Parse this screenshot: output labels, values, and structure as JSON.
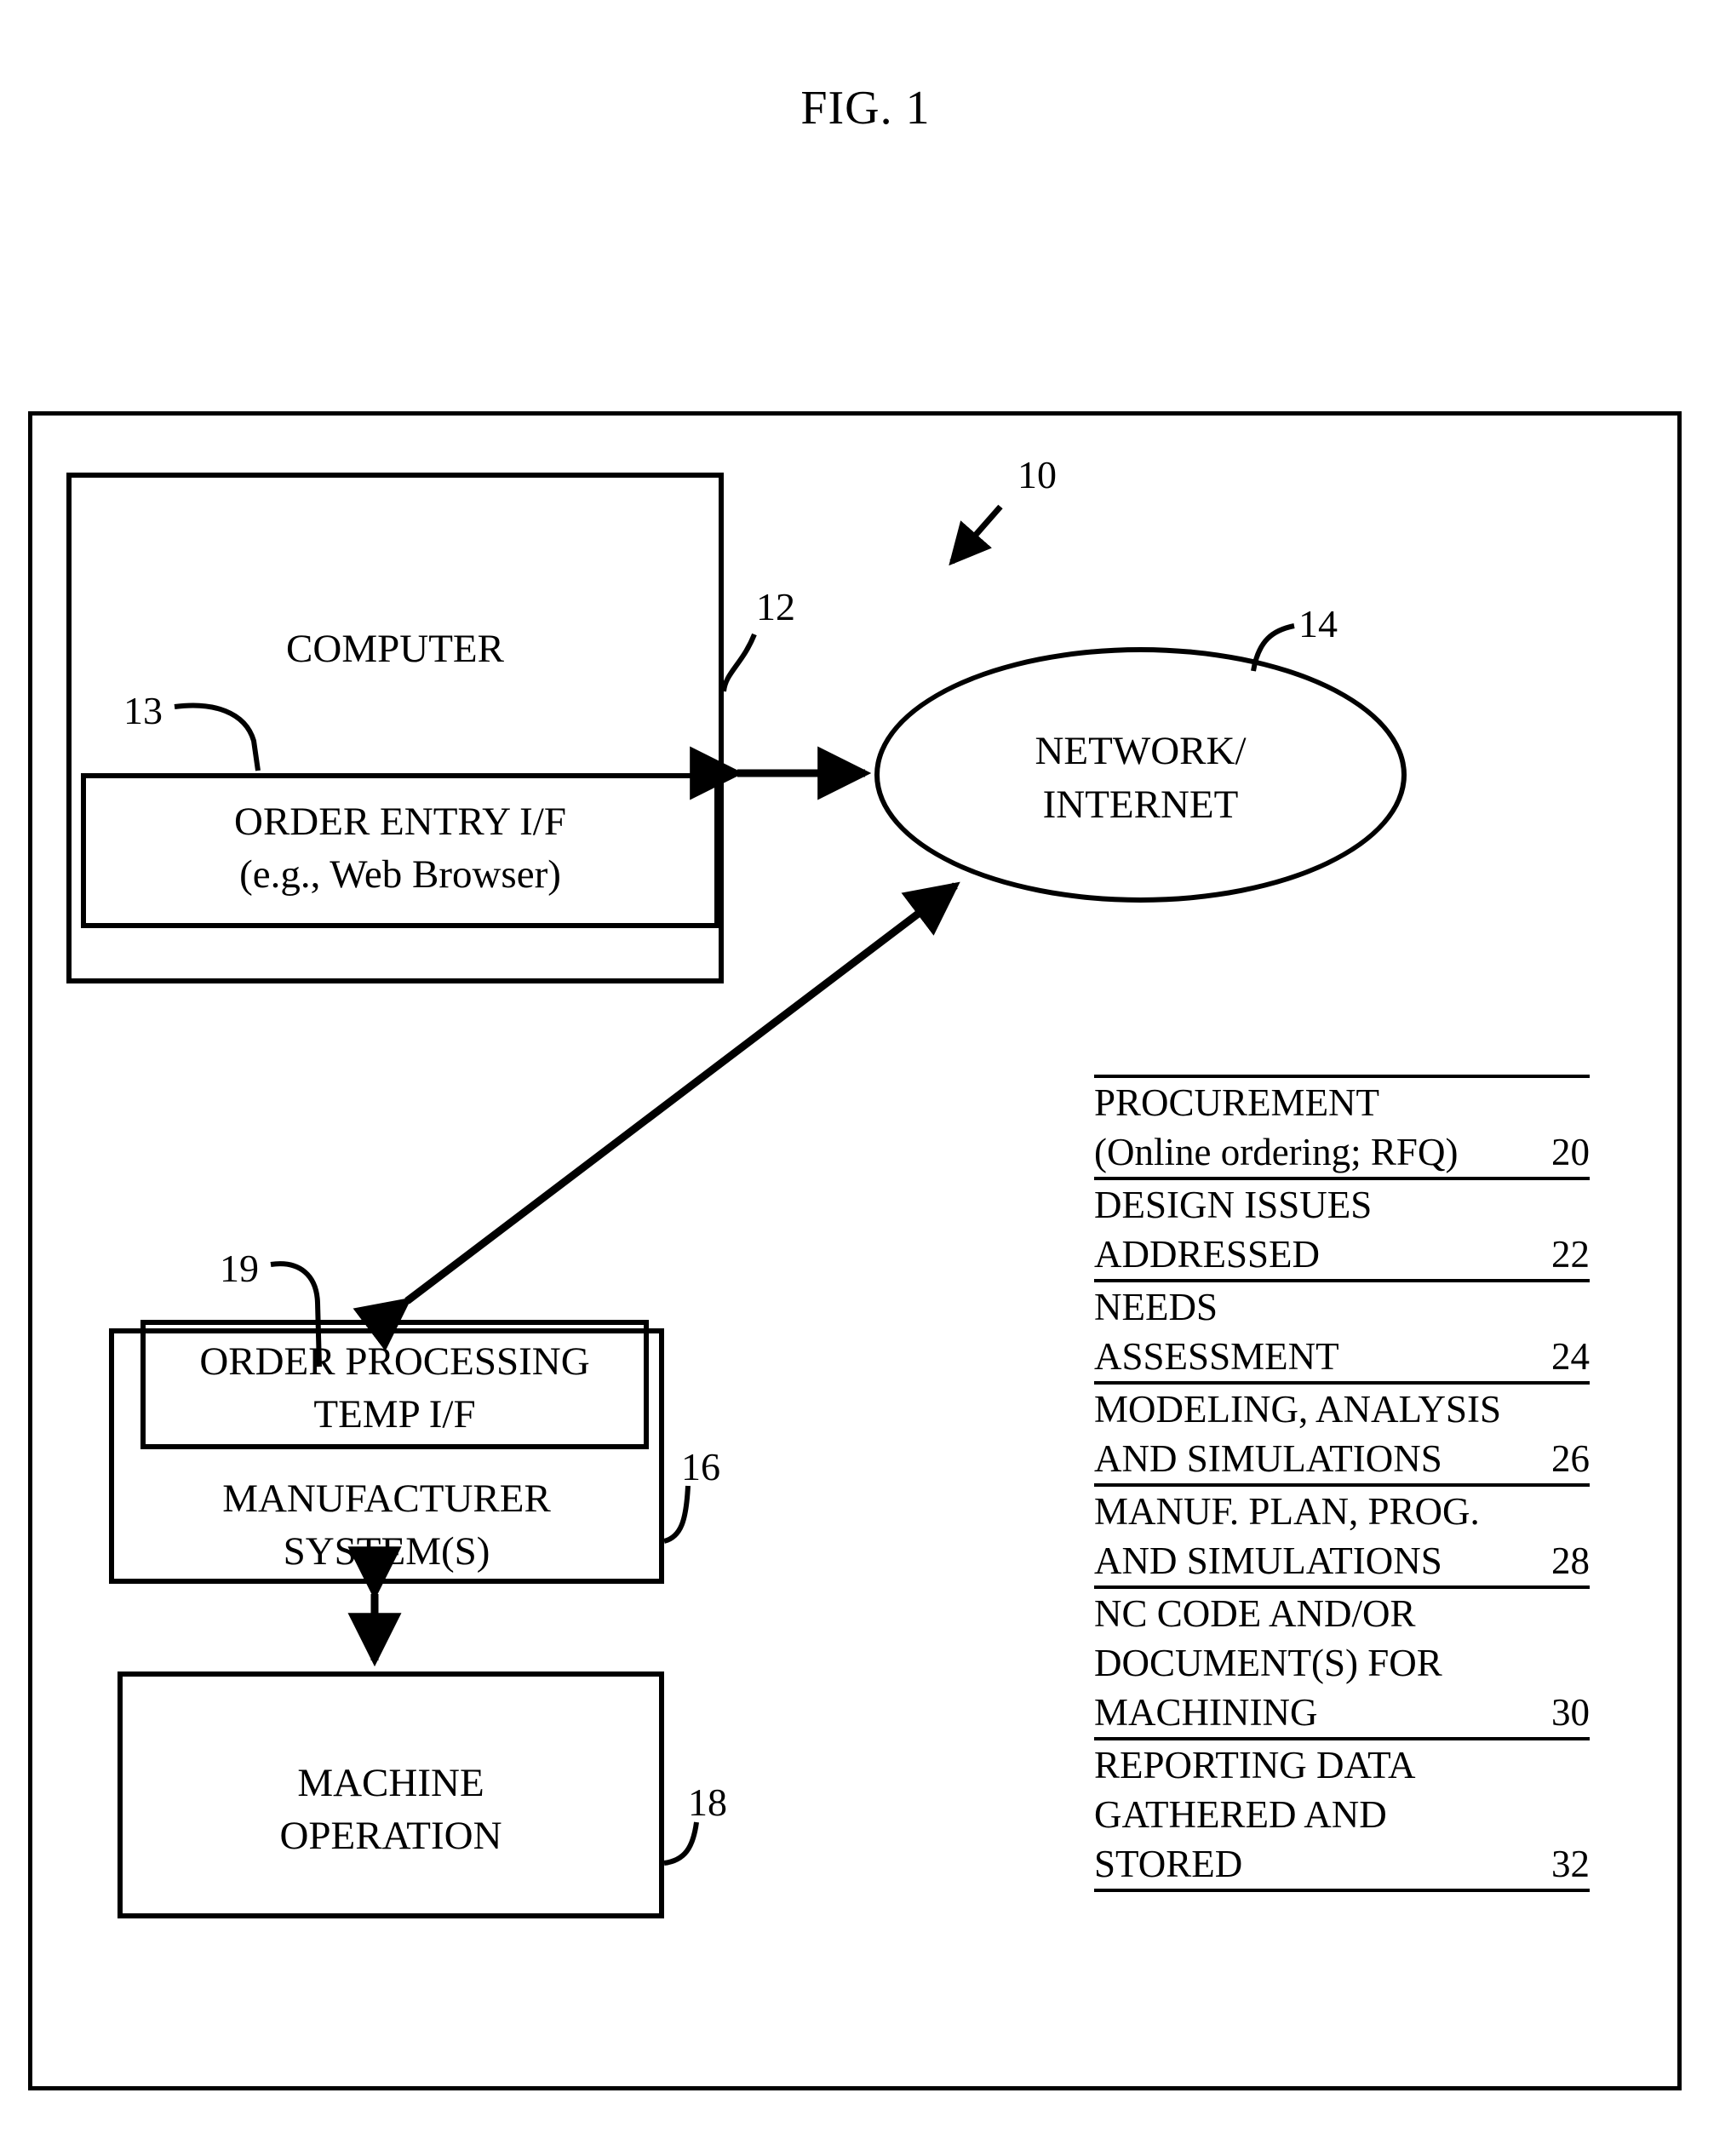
{
  "figure": {
    "title": "FIG. 1"
  },
  "diagram": {
    "computer": {
      "label": "COMPUTER",
      "ref": "12",
      "order_entry": {
        "line1": "ORDER ENTRY I/F",
        "line2": "(e.g., Web Browser)",
        "ref": "13"
      }
    },
    "network": {
      "line1": "NETWORK/",
      "line2": "INTERNET",
      "ref": "14"
    },
    "system_ref": "10",
    "manufacturer": {
      "line1": "MANUFACTURER",
      "line2": "SYSTEM(S)",
      "ref": "16",
      "order_processing": {
        "line1": "ORDER PROCESSING",
        "line2": "TEMP I/F",
        "ref": "19"
      }
    },
    "machine": {
      "line1": "MACHINE",
      "line2": "OPERATION",
      "ref": "18"
    }
  },
  "process_list": [
    {
      "lines": [
        "PROCUREMENT",
        "(Online ordering; RFQ)"
      ],
      "ref": "20"
    },
    {
      "lines": [
        "DESIGN ISSUES",
        "ADDRESSED"
      ],
      "ref": "22"
    },
    {
      "lines": [
        "NEEDS",
        "ASSESSMENT"
      ],
      "ref": "24"
    },
    {
      "lines": [
        "MODELING, ANALYSIS",
        "AND SIMULATIONS"
      ],
      "ref": "26"
    },
    {
      "lines": [
        "MANUF. PLAN, PROG.",
        "AND SIMULATIONS"
      ],
      "ref": "28"
    },
    {
      "lines": [
        "NC CODE AND/OR",
        "DOCUMENT(S) FOR",
        "MACHINING"
      ],
      "ref": "30"
    },
    {
      "lines": [
        "REPORTING DATA",
        "GATHERED AND",
        "STORED"
      ],
      "ref": "32"
    }
  ]
}
